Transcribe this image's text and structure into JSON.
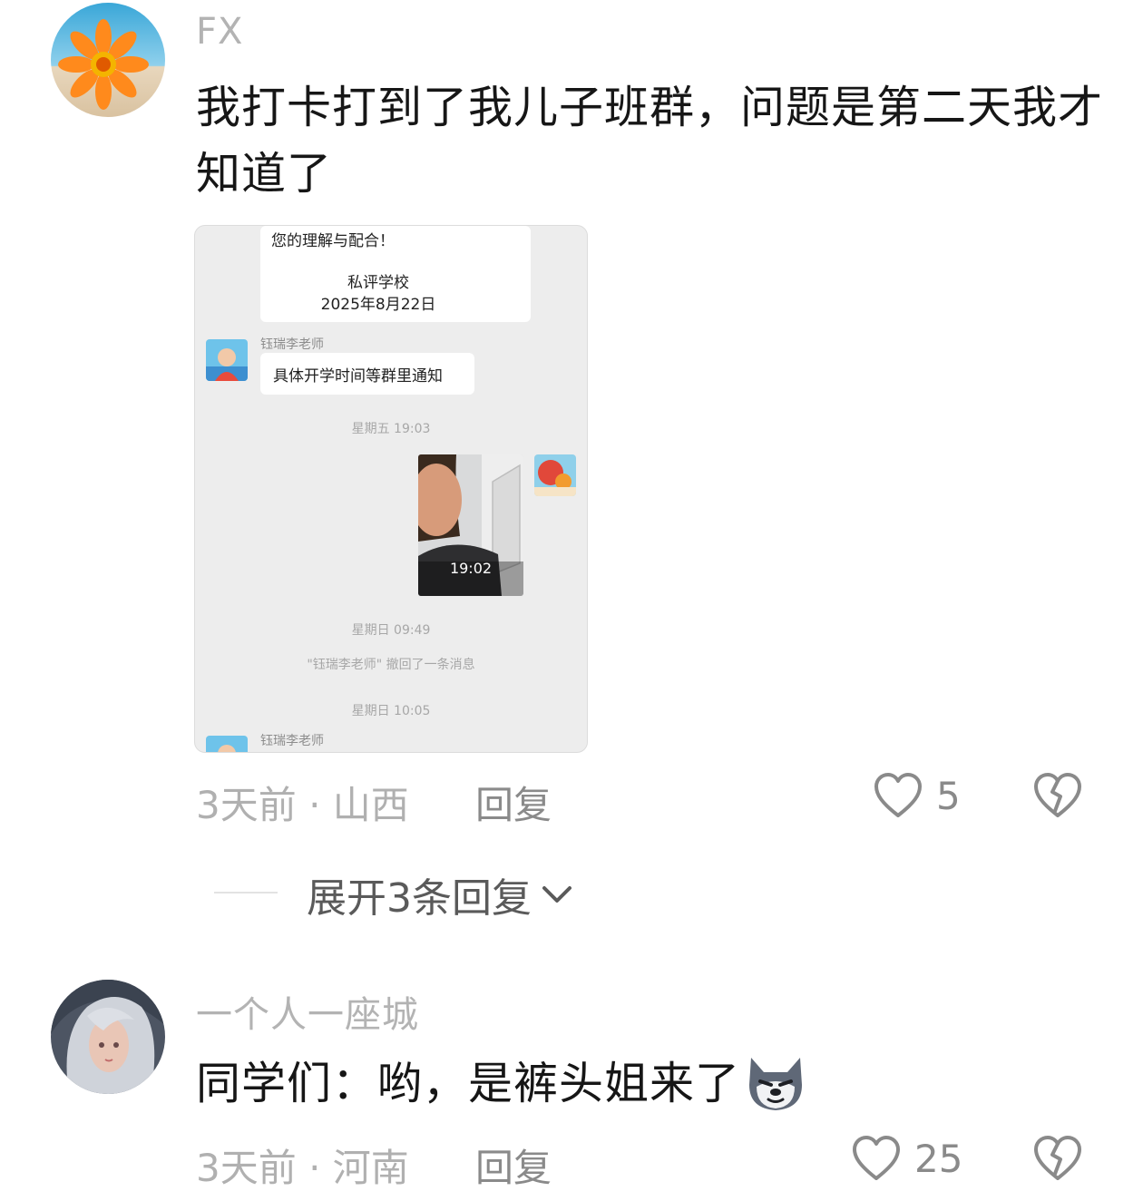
{
  "comments": [
    {
      "username": "FX",
      "text": "我打卡打到了我儿子班群，问题是第二天我才知道了",
      "time_location": "3天前 · 山西",
      "reply_label": "回复",
      "likes": "5",
      "screenshot": {
        "notice_line1": "您的理解与配合！",
        "notice_school": "私评学校",
        "notice_date": "2025年8月22日",
        "teacher_name": "钰瑞李老师",
        "teacher_message": "具体开学时间等群里通知",
        "time1": "星期五 19:03",
        "photo_clock": "19:02",
        "time2": "星期日 09:49",
        "recall_notice": "\"钰瑞李老师\" 撤回了一条消息",
        "time3": "星期日 10:05",
        "teacher_name2": "钰瑞李老师"
      }
    },
    {
      "username": "一个人一座城",
      "text": "同学们：哟，是裤头姐来了",
      "time_location": "3天前 · 河南",
      "reply_label": "回复",
      "likes": "25"
    }
  ],
  "expand_replies": "展开3条回复",
  "icons": [
    "heart-outline-icon",
    "broken-heart-icon",
    "chevron-down-icon",
    "wolf-emoji-icon"
  ],
  "colors": {
    "text": "#161616",
    "muted": "#b0b0b0",
    "icon": "#8a8a8a",
    "card_bg": "#ededed"
  }
}
